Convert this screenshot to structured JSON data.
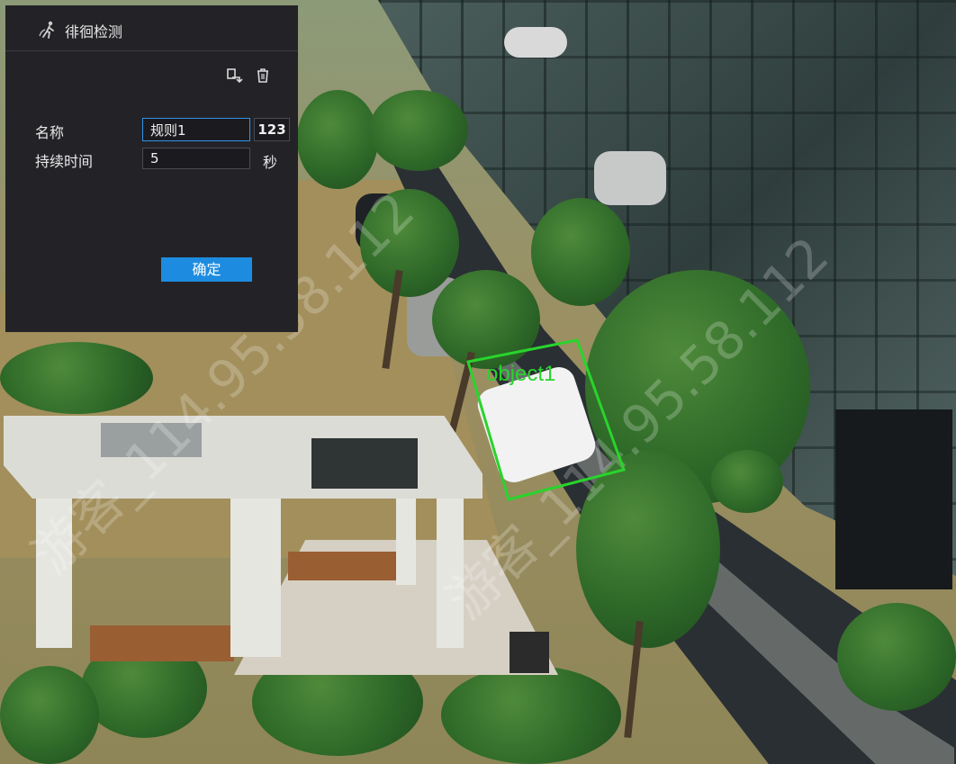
{
  "dialog": {
    "title": "徘徊检测",
    "header_icon": "person-walking-icon",
    "toolbar": {
      "draw_icon": "draw-area-icon",
      "delete_icon": "trash-icon"
    },
    "fields": {
      "name_label": "名称",
      "name_value": "规则1",
      "keyboard_toggle": "123",
      "duration_label": "持续时间",
      "duration_value": "5",
      "duration_unit": "秒"
    },
    "ok_label": "确定"
  },
  "scene": {
    "detection_label": "object1",
    "detection_color": "#29d42c",
    "watermark_text": "游客_114.95.58.112"
  }
}
